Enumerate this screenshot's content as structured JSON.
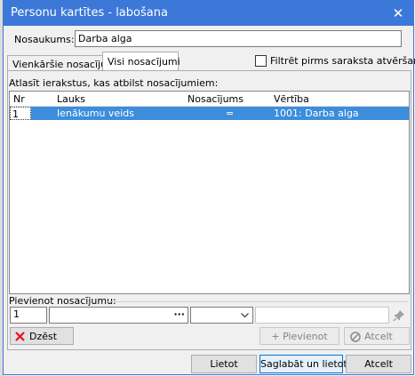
{
  "window": {
    "title": "Personu kartītes - labošana",
    "close_glyph": "✕"
  },
  "name_field": {
    "label": "Nosaukums:",
    "value": "Darba alga"
  },
  "tabs": [
    {
      "label": "Vienkāršie nosacījumi",
      "active": false
    },
    {
      "label": "Visi nosacījumi",
      "active": true
    }
  ],
  "filter_checkbox": {
    "label": "Filtrēt pirms saraksta atvēršanas",
    "checked": false
  },
  "grid": {
    "caption": "Atlasīt ierakstus, kas atbilst nosacījumiem:",
    "columns": [
      "Nr",
      "Lauks",
      "Nosacījums",
      "Vērtība"
    ],
    "rows": [
      {
        "nr": "1",
        "lauks": "Ienākumu veids",
        "nosacijums": "=",
        "vertiba": "1001: Darba alga",
        "selected": true
      }
    ]
  },
  "add_condition": {
    "label": "Pievienot nosacījumu:",
    "number_value": "1",
    "field_value": "",
    "field_button": "···",
    "operator_value": "",
    "value_text": ""
  },
  "buttons": {
    "delete": "Dzēst",
    "add": "+ Pievienot",
    "cancel_condition": "Atcelt",
    "apply": "Lietot",
    "save_apply": "Saglabāt un lietot",
    "cancel": "Atcelt"
  },
  "colors": {
    "titlebar": "#3c78d8",
    "selection": "#3c8ddc",
    "delete_icon": "#e81123"
  }
}
